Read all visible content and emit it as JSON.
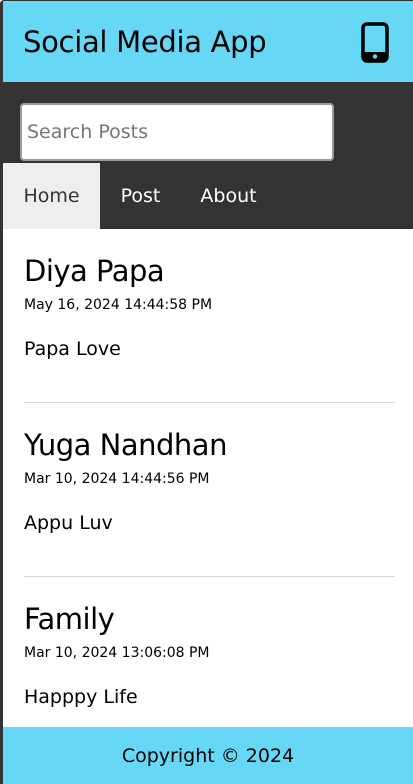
{
  "header": {
    "title": "Social Media App",
    "icon": "mobile-phone-icon"
  },
  "search": {
    "placeholder": "Search Posts",
    "value": ""
  },
  "nav": {
    "tabs": [
      {
        "label": "Home",
        "active": true
      },
      {
        "label": "Post",
        "active": false
      },
      {
        "label": "About",
        "active": false
      }
    ]
  },
  "posts": [
    {
      "title": "Diya Papa",
      "datetime": "May 16, 2024 14:44:58 PM",
      "body": "Papa Love"
    },
    {
      "title": "Yuga Nandhan",
      "datetime": "Mar 10, 2024 14:44:56 PM",
      "body": "Appu Luv"
    },
    {
      "title": "Family",
      "datetime": "Mar 10, 2024 13:06:08 PM",
      "body": "Happpy Life"
    }
  ],
  "footer": {
    "text": "Copyright © 2024"
  },
  "colors": {
    "header_bg": "#66d8f5",
    "nav_bg": "#333333",
    "active_tab_bg": "#eeeeee",
    "footer_bg": "#66d8f5"
  }
}
